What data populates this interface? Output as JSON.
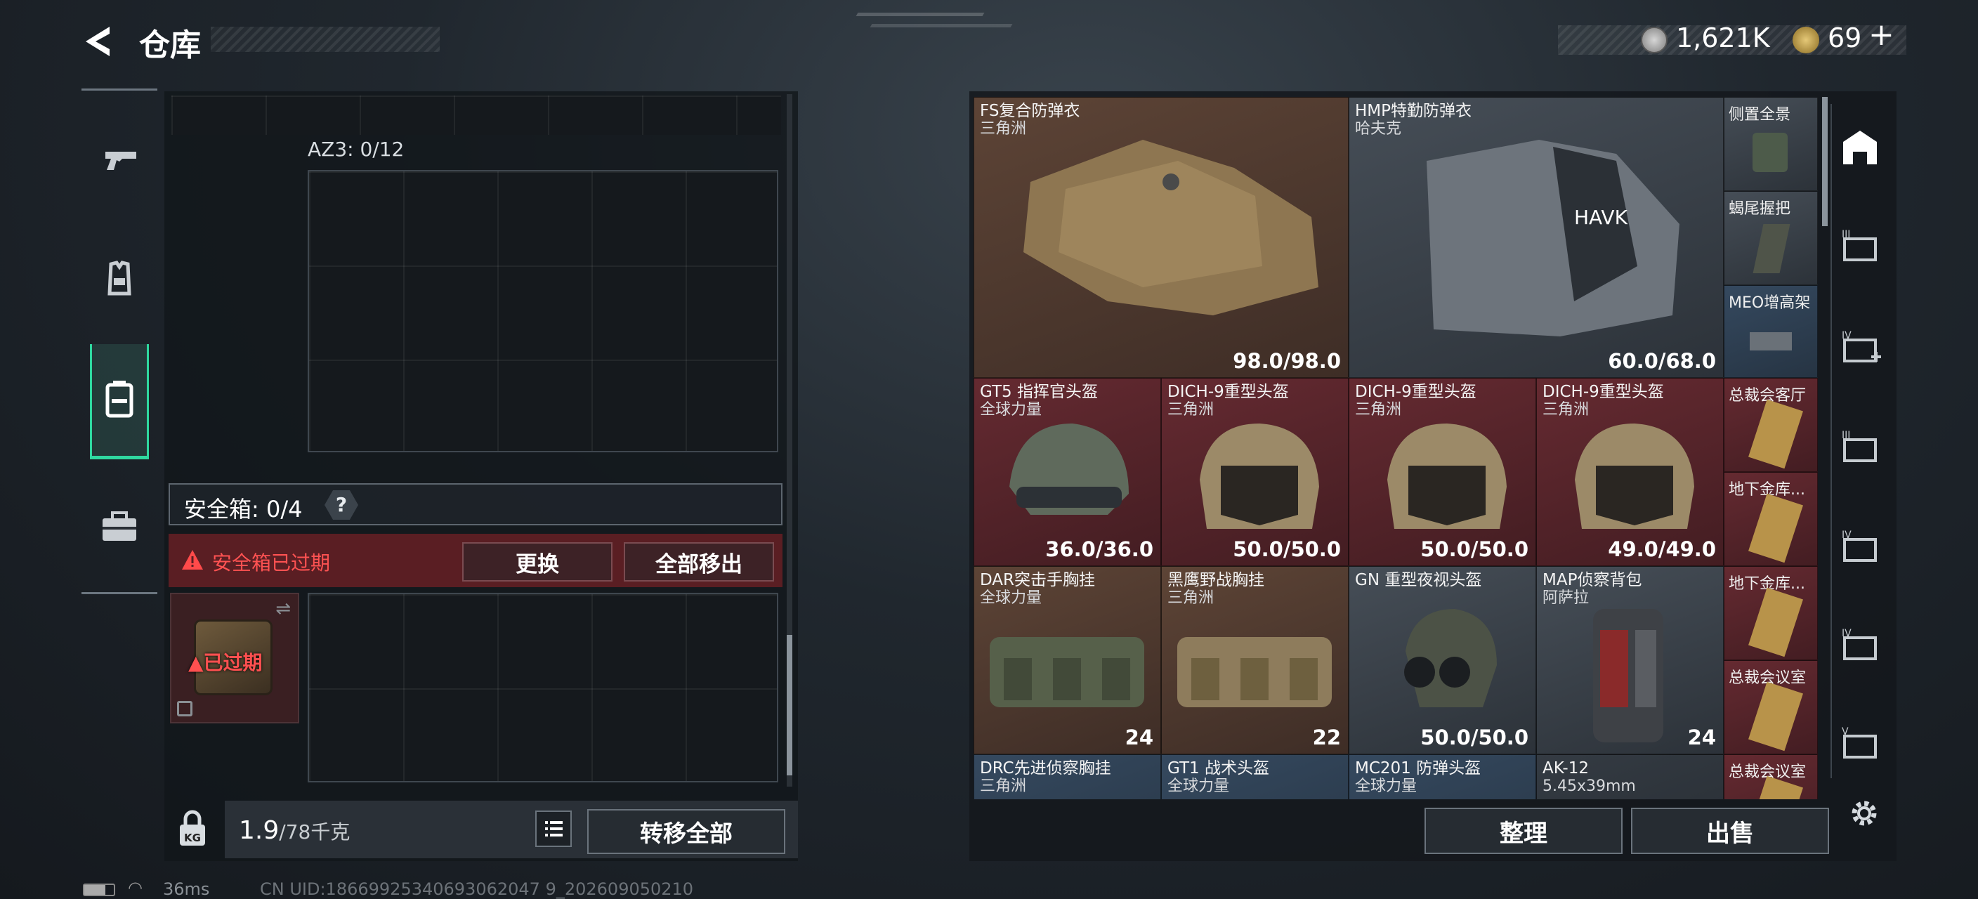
{
  "header": {
    "title": "仓库",
    "currency": "1,621K",
    "tickets": "69"
  },
  "left": {
    "container_label": "AZ3: 0/12",
    "safebox_label": "安全箱: 0/4",
    "help_mark": "?",
    "expired_warning": "安全箱已过期",
    "replace_btn": "更换",
    "remove_all_btn": "全部移出",
    "expired_tag": "已过期",
    "weight": "1.9",
    "weight_max": "/78千克",
    "weight_badge": "KG",
    "transfer_all_btn": "转移全部"
  },
  "status": {
    "latency": "36ms",
    "uid": "CN UID:18669925340693062047 9_202609050210"
  },
  "items": [
    {
      "name": "FS复合防弹衣",
      "sub": "三角洲",
      "durability": "98.0/98.0"
    },
    {
      "name": "HMP特勤防弹衣",
      "sub": "哈夫克",
      "durability": "60.0/68.0"
    },
    {
      "name": "GT5 指挥官头盔",
      "sub": "全球力量",
      "durability": "36.0/36.0"
    },
    {
      "name": "DICH-9重型头盔",
      "sub": "三角洲",
      "durability": "50.0/50.0"
    },
    {
      "name": "DICH-9重型头盔",
      "sub": "三角洲",
      "durability": "50.0/50.0"
    },
    {
      "name": "DICH-9重型头盔",
      "sub": "三角洲",
      "durability": "49.0/49.0"
    },
    {
      "name": "DAR突击手胸挂",
      "sub": "全球力量",
      "count": "24"
    },
    {
      "name": "黑鹰野战胸挂",
      "sub": "三角洲",
      "count": "22"
    },
    {
      "name": "GN 重型夜视头盔",
      "sub": "",
      "durability": "50.0/50.0"
    },
    {
      "name": "MAP侦察背包",
      "sub": "阿萨拉",
      "count": "24"
    },
    {
      "name": "DRC先进侦察胸挂",
      "sub": "三角洲"
    },
    {
      "name": "GT1 战术头盔",
      "sub": "全球力量"
    },
    {
      "name": "MC201 防弹头盔",
      "sub": "全球力量"
    },
    {
      "name": "AK-12",
      "sub": "5.45x39mm"
    }
  ],
  "side_items": [
    "侧置全景",
    "蝎尾握把",
    "MEO增高架",
    "总裁会客厅",
    "地下金库...",
    "地下金库...",
    "总裁会议室",
    "总裁会议室"
  ],
  "buttons": {
    "organize": "整理",
    "sell": "出售"
  },
  "icons": [
    "back-arrow-icon",
    "coin-icon",
    "ticket-icon",
    "pistol-icon",
    "armor-icon",
    "backpack-icon",
    "toolbox-icon",
    "lock-icon",
    "list-icon",
    "warning-icon",
    "safe-icon",
    "home-icon",
    "storage-3-icon",
    "storage-4-add-icon",
    "storage-3b-icon",
    "storage-4-icon",
    "storage-4b-icon",
    "storage-5-icon",
    "settings-icon",
    "battery-icon",
    "wifi-icon"
  ]
}
